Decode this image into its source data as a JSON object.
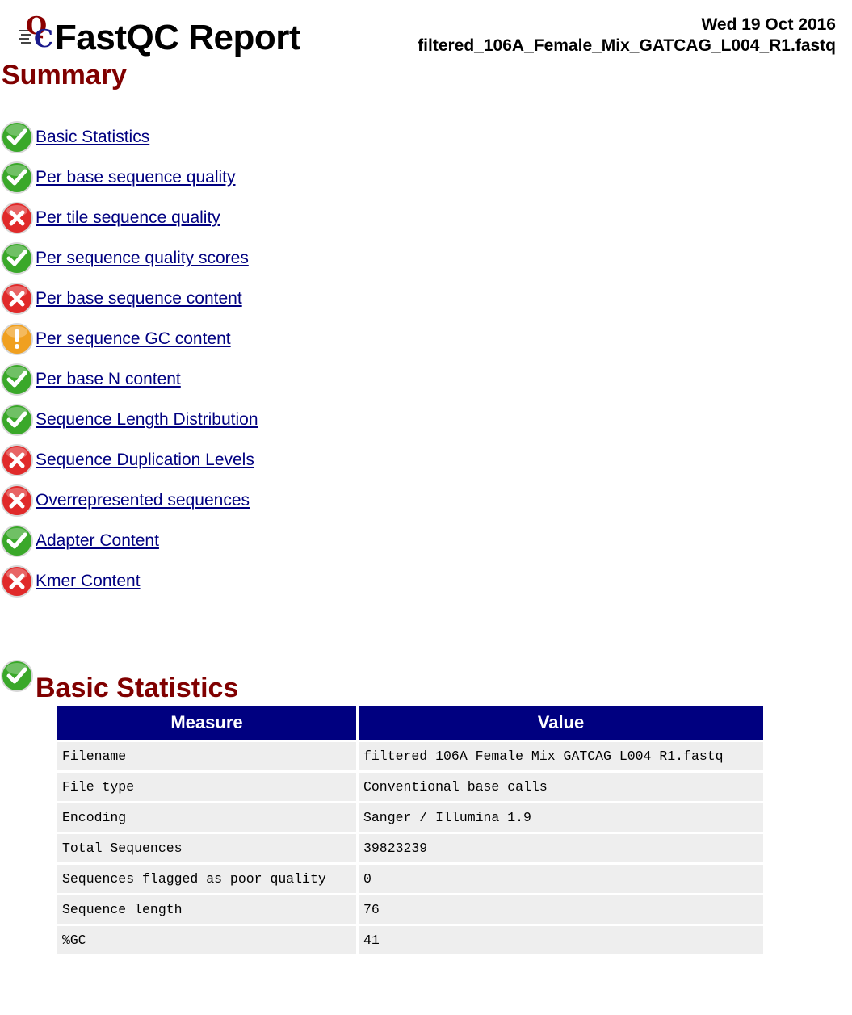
{
  "header": {
    "title": "FastQC Report",
    "date": "Wed 19 Oct 2016",
    "filename": "filtered_106A_Female_Mix_GATCAG_L004_R1.fastq"
  },
  "summary": {
    "title": "Summary",
    "items": [
      {
        "label": "Basic Statistics",
        "status": "pass"
      },
      {
        "label": "Per base sequence quality",
        "status": "pass"
      },
      {
        "label": "Per tile sequence quality",
        "status": "fail"
      },
      {
        "label": "Per sequence quality scores",
        "status": "pass"
      },
      {
        "label": "Per base sequence content",
        "status": "fail"
      },
      {
        "label": "Per sequence GC content",
        "status": "warn"
      },
      {
        "label": "Per base N content",
        "status": "pass"
      },
      {
        "label": "Sequence Length Distribution",
        "status": "pass"
      },
      {
        "label": "Sequence Duplication Levels",
        "status": "fail"
      },
      {
        "label": "Overrepresented sequences",
        "status": "fail"
      },
      {
        "label": "Adapter Content",
        "status": "pass"
      },
      {
        "label": "Kmer Content",
        "status": "fail"
      }
    ]
  },
  "basic_statistics": {
    "title": "Basic Statistics",
    "status": "pass",
    "columns": [
      "Measure",
      "Value"
    ],
    "rows": [
      [
        "Filename",
        "filtered_106A_Female_Mix_GATCAG_L004_R1.fastq"
      ],
      [
        "File type",
        "Conventional base calls"
      ],
      [
        "Encoding",
        "Sanger / Illumina 1.9"
      ],
      [
        "Total Sequences",
        "39823239"
      ],
      [
        "Sequences flagged as poor quality",
        "0"
      ],
      [
        "Sequence length",
        "76"
      ],
      [
        "%GC",
        "41"
      ]
    ]
  },
  "colors": {
    "heading": "#800000",
    "link": "#000080",
    "table_header": "#000080",
    "table_cell": "#eeeeee",
    "pass": "#3aa82a",
    "fail": "#e02a2a",
    "warn": "#f0a020"
  },
  "icons": {
    "pass": "check-icon",
    "fail": "cross-icon",
    "warn": "exclamation-icon",
    "logo": "fastqc-logo-icon"
  }
}
